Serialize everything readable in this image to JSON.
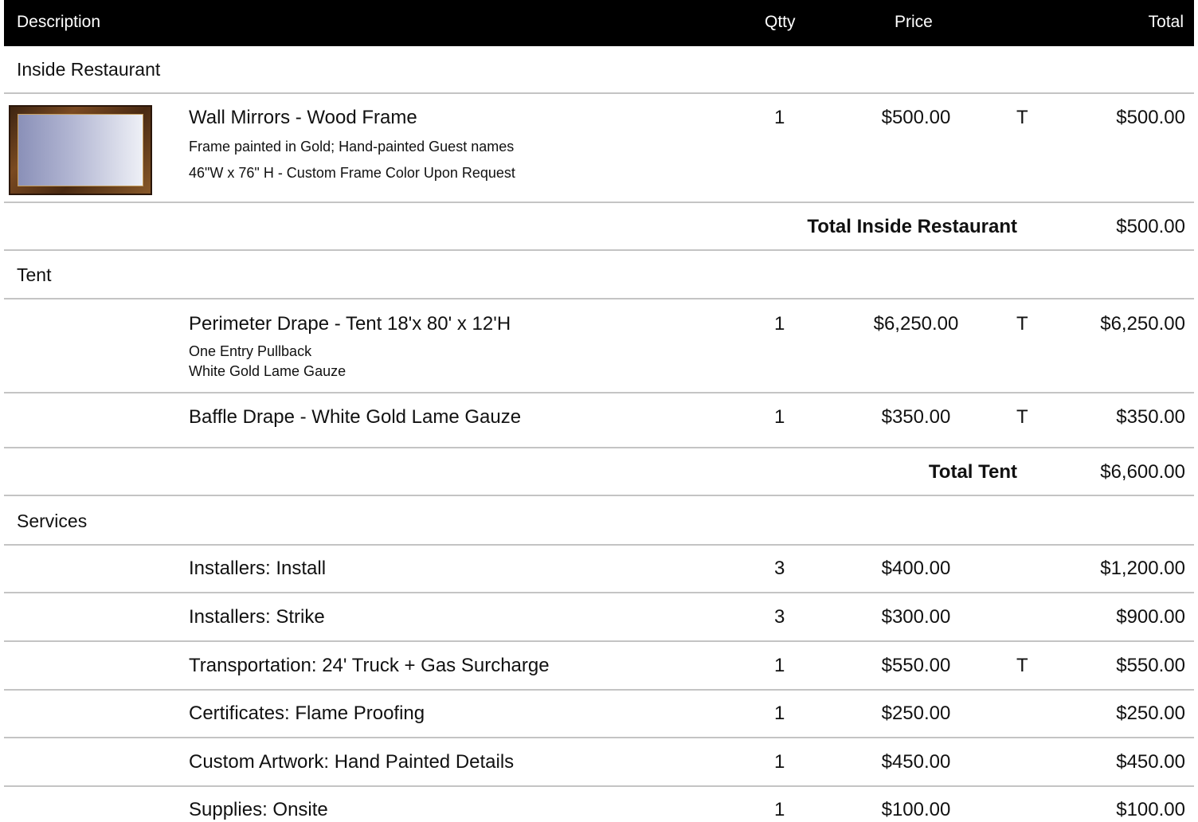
{
  "header": {
    "description": "Description",
    "qty": "Qtty",
    "price": "Price",
    "total": "Total"
  },
  "sections": [
    {
      "title": "Inside Restaurant",
      "items": [
        {
          "name": "Wall Mirrors - Wood Frame",
          "notes": [
            "Frame painted in Gold; Hand-painted Guest names",
            "46\"W  x 76\" H - Custom Frame Color Upon Request"
          ],
          "qty": "1",
          "price": "$500.00",
          "tax": "T",
          "total": "$500.00",
          "image": "wall-mirror-wood-frame"
        }
      ],
      "subtotal_label": "Total Inside Restaurant",
      "subtotal": "$500.00"
    },
    {
      "title": "Tent",
      "items": [
        {
          "name": "Perimeter Drape  - Tent 18'x 80' x 12'H",
          "notes": [
            "One Entry Pullback",
            "White Gold Lame Gauze"
          ],
          "qty": "1",
          "price": "$6,250.00",
          "tax": "T",
          "total": "$6,250.00"
        },
        {
          "name": "Baffle Drape - White Gold Lame Gauze",
          "qty": "1",
          "price": "$350.00",
          "tax": "T",
          "total": "$350.00"
        }
      ],
      "subtotal_label": "Total Tent",
      "subtotal": "$6,600.00"
    },
    {
      "title": "Services",
      "items": [
        {
          "name": "Installers: Install",
          "qty": "3",
          "price": "$400.00",
          "tax": "",
          "total": "$1,200.00"
        },
        {
          "name": "Installers: Strike",
          "qty": "3",
          "price": "$300.00",
          "tax": "",
          "total": "$900.00"
        },
        {
          "name": "Transportation: 24' Truck + Gas Surcharge",
          "qty": "1",
          "price": "$550.00",
          "tax": "T",
          "total": "$550.00"
        },
        {
          "name": "Certificates: Flame Proofing",
          "qty": "1",
          "price": "$250.00",
          "tax": "",
          "total": "$250.00"
        },
        {
          "name": "Custom Artwork: Hand Painted Details",
          "qty": "1",
          "price": "$450.00",
          "tax": "",
          "total": "$450.00"
        },
        {
          "name": "Supplies: Onsite",
          "qty": "1",
          "price": "$100.00",
          "tax": "",
          "total": "$100.00"
        }
      ]
    }
  ]
}
